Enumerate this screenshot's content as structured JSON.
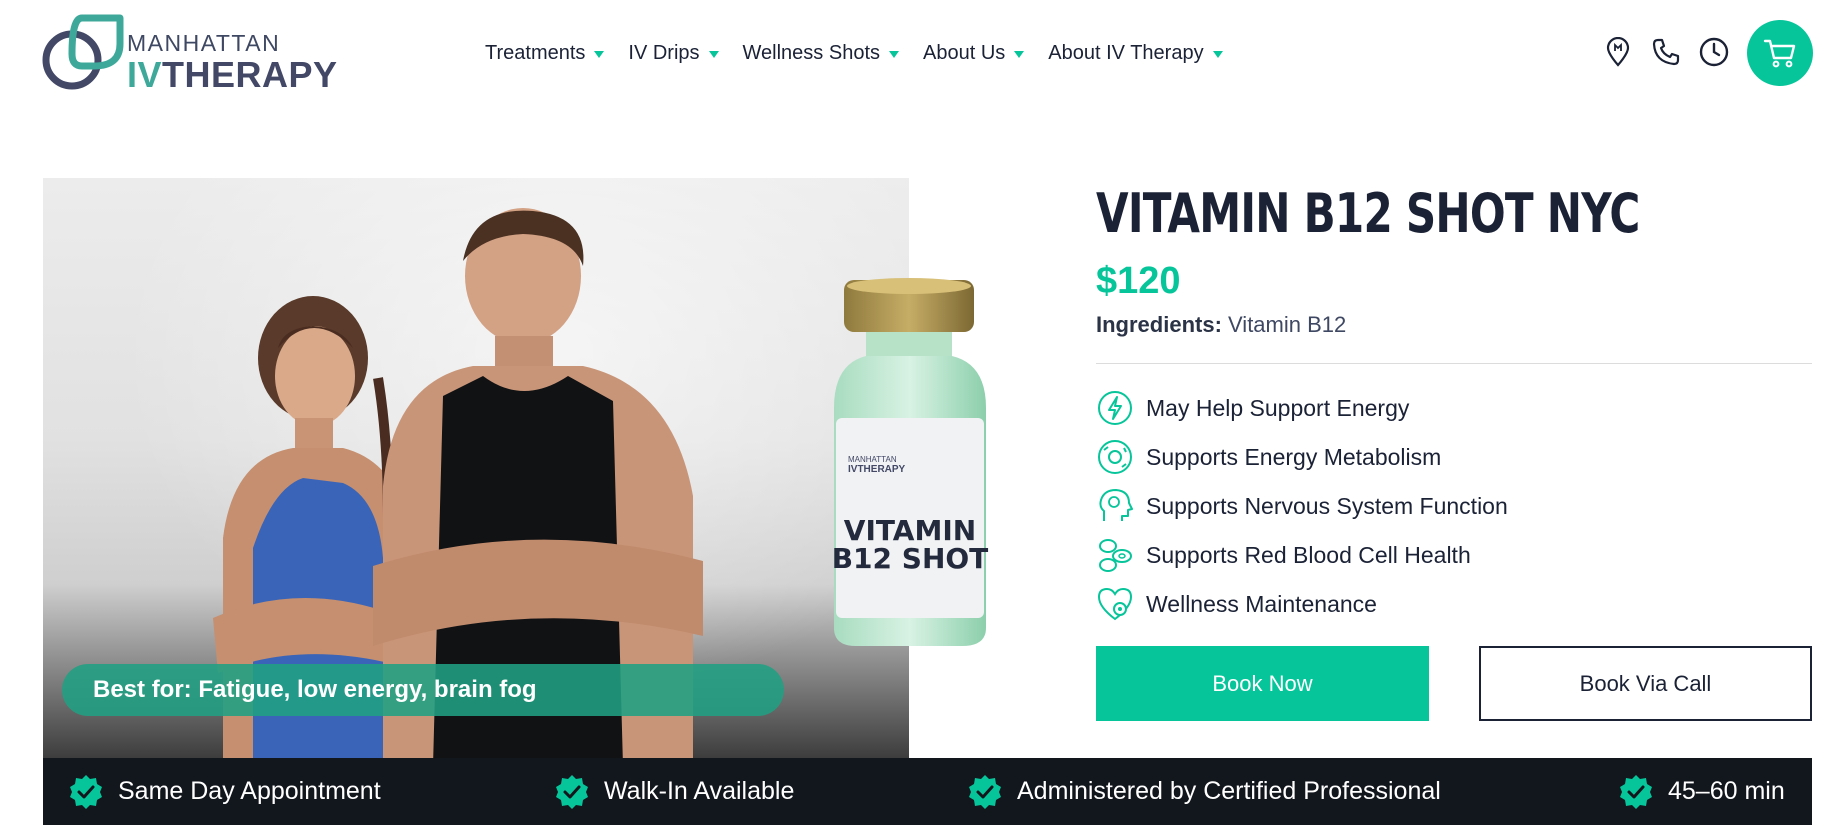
{
  "brand": {
    "name_top": "MANHATTAN",
    "name_bottom_accent": "IV",
    "name_bottom_rest": "THERAPY",
    "logo_icon": "leaf-ring-logo"
  },
  "nav": {
    "items": [
      {
        "label": "Treatments"
      },
      {
        "label": "IV Drips"
      },
      {
        "label": "Wellness Shots"
      },
      {
        "label": "About Us"
      },
      {
        "label": "About IV Therapy"
      }
    ]
  },
  "header_icons": [
    "location-pin-icon",
    "phone-icon",
    "clock-icon",
    "cart-icon"
  ],
  "hero": {
    "best_for": "Best for: Fatigue, low energy, brain fog",
    "vial_brand_top": "MANHATTAN",
    "vial_brand_bottom": "IVTHERAPY",
    "vial_label_line1": "VITAMIN",
    "vial_label_line2": "B12 SHOT"
  },
  "product": {
    "title": "VITAMIN B12 SHOT NYC",
    "price": "$120",
    "ingredients_label": "Ingredients:",
    "ingredients_value": "Vitamin B12",
    "benefits": [
      {
        "icon": "energy-bolt-icon",
        "label": "May Help Support Energy"
      },
      {
        "icon": "metabolism-cycle-icon",
        "label": "Supports Energy Metabolism"
      },
      {
        "icon": "brain-head-icon",
        "label": "Supports Nervous System Function"
      },
      {
        "icon": "blood-cells-icon",
        "label": "Supports Red Blood Cell Health"
      },
      {
        "icon": "heart-gear-icon",
        "label": "Wellness Maintenance"
      }
    ],
    "book_now_label": "Book Now",
    "book_call_label": "Book Via Call"
  },
  "features": [
    {
      "icon": "verified-check-icon",
      "label": "Same Day Appointment"
    },
    {
      "icon": "verified-check-icon",
      "label": "Walk-In Available"
    },
    {
      "icon": "verified-check-icon",
      "label": "Administered by Certified Professional"
    },
    {
      "icon": "verified-check-icon",
      "label": "45–60 min"
    }
  ],
  "colors": {
    "accent": "#07c59a",
    "navy": "#1b2236",
    "bar": "#12161d",
    "logo_teal": "#3ea99a",
    "logo_slate": "#424866"
  }
}
